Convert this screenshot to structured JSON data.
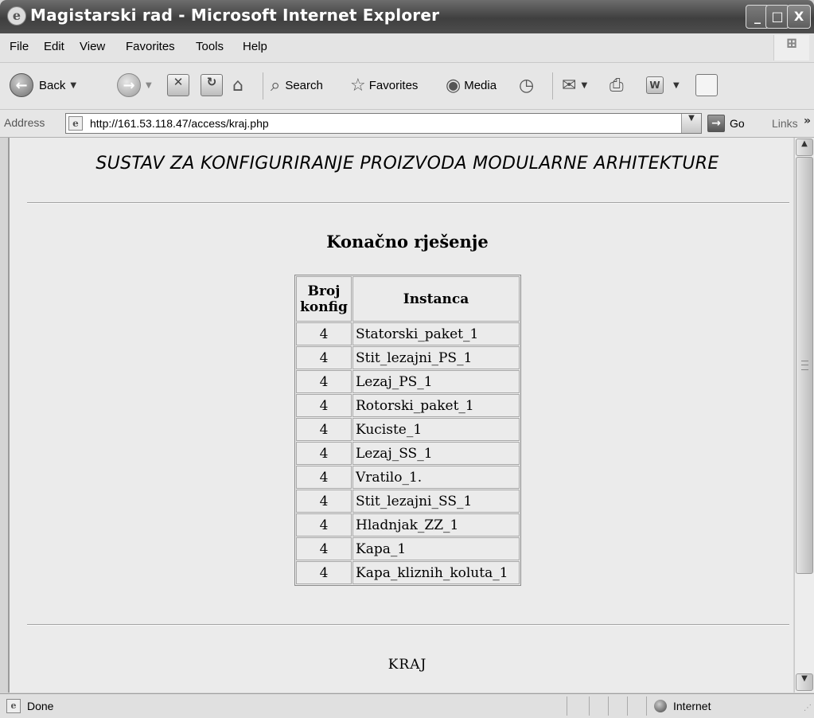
{
  "window": {
    "title": "Magistarski rad - Microsoft Internet Explorer",
    "min_glyph": "_",
    "max_glyph": "□",
    "close_glyph": "X"
  },
  "menu": [
    "File",
    "Edit",
    "View",
    "Favorites",
    "Tools",
    "Help"
  ],
  "toolbar": {
    "back_label": "Back",
    "search_label": "Search",
    "favorites_label": "Favorites",
    "media_label": "Media"
  },
  "address": {
    "label": "Address",
    "url": "http://161.53.118.47/access/kraj.php",
    "go_label": "Go",
    "links_label": "Links"
  },
  "page": {
    "heading": "SUSTAV ZA KONFIGURIRANJE PROIZVODA MODULARNE ARHITEKTURE",
    "subtitle": "Konačno rješenje",
    "table": {
      "headers": [
        "Broj konfig",
        "Instanca"
      ],
      "rows": [
        {
          "broj": "4",
          "instanca": "Statorski_paket_1"
        },
        {
          "broj": "4",
          "instanca": "Stit_lezajni_PS_1"
        },
        {
          "broj": "4",
          "instanca": "Lezaj_PS_1"
        },
        {
          "broj": "4",
          "instanca": "Rotorski_paket_1"
        },
        {
          "broj": "4",
          "instanca": "Kuciste_1"
        },
        {
          "broj": "4",
          "instanca": "Lezaj_SS_1"
        },
        {
          "broj": "4",
          "instanca": "Vratilo_1."
        },
        {
          "broj": "4",
          "instanca": "Stit_lezajni_SS_1"
        },
        {
          "broj": "4",
          "instanca": "Hladnjak_ZZ_1"
        },
        {
          "broj": "4",
          "instanca": "Kapa_1"
        },
        {
          "broj": "4",
          "instanca": "Kapa_kliznih_koluta_1"
        }
      ]
    },
    "footer_link": "KRAJ"
  },
  "status": {
    "text": "Done",
    "zone": "Internet"
  }
}
